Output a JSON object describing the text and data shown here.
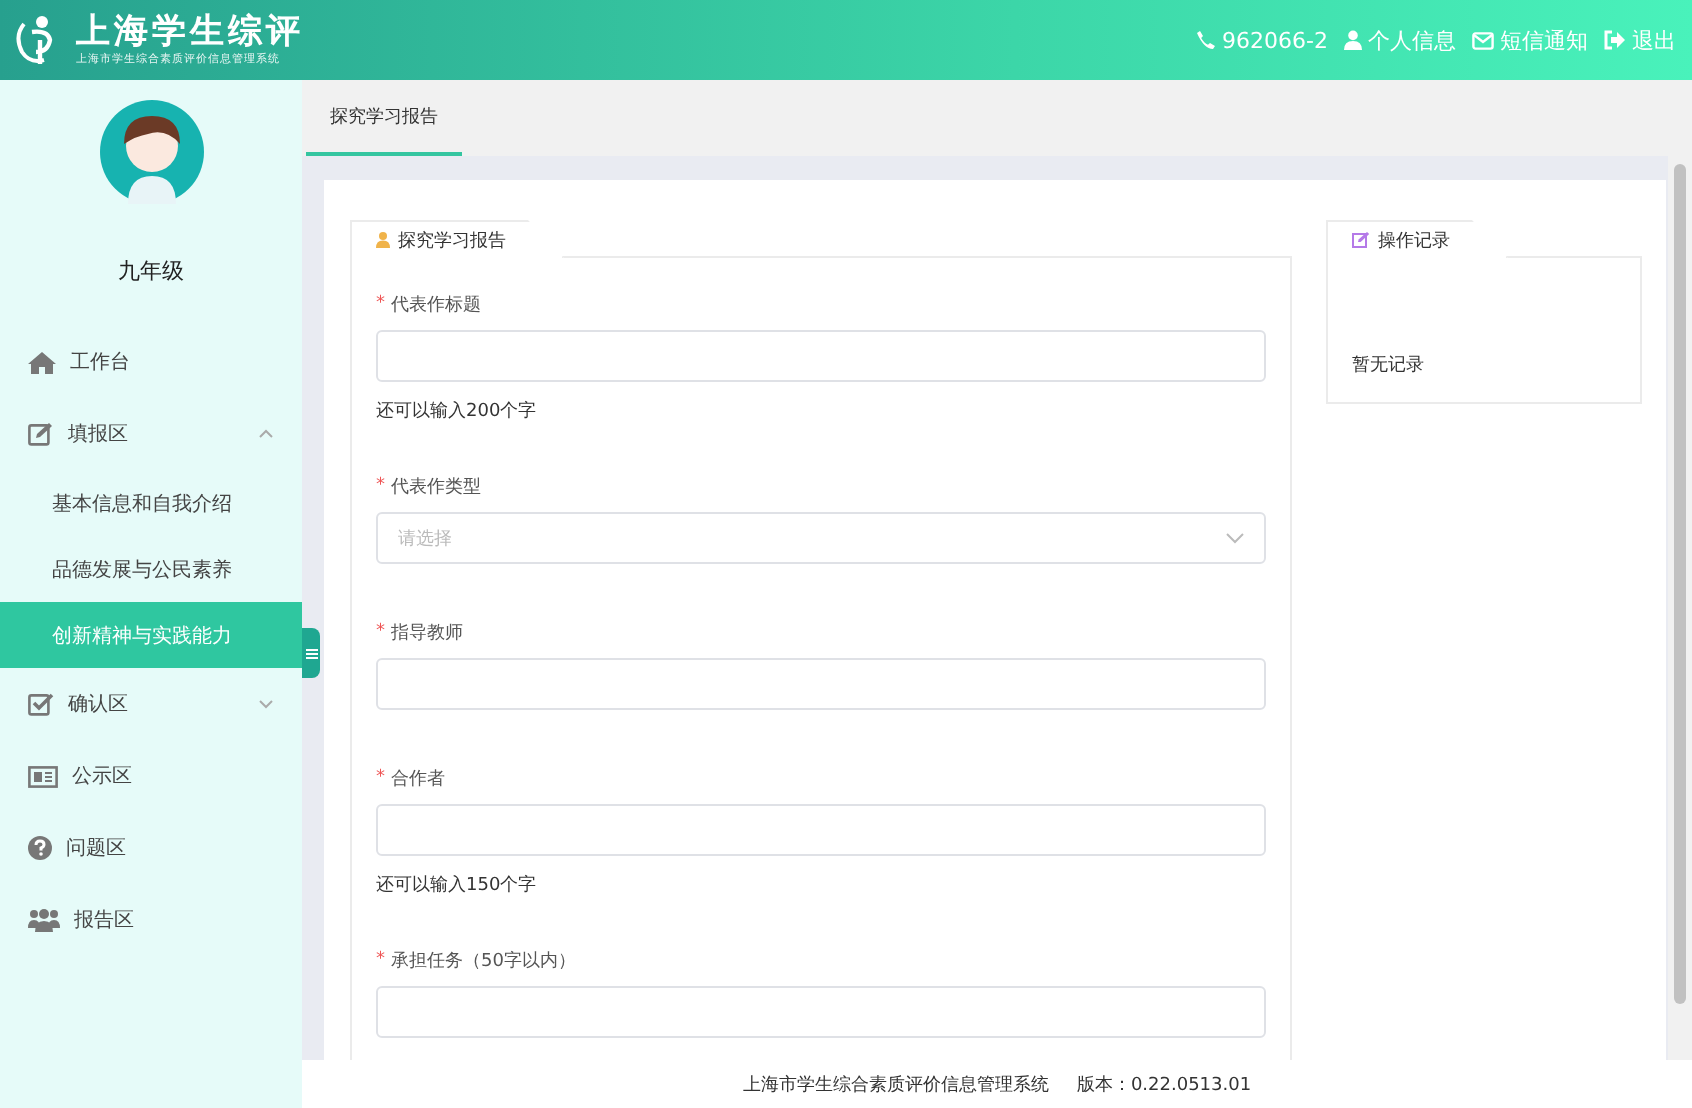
{
  "header": {
    "title": "上海学生综评",
    "subtitle": "上海市学生综合素质评价信息管理系统",
    "links": [
      {
        "kind": "phone",
        "label": "962066-2"
      },
      {
        "kind": "user",
        "label": "个人信息"
      },
      {
        "kind": "mail",
        "label": "短信通知"
      },
      {
        "kind": "logout",
        "label": "退出"
      }
    ]
  },
  "sidebar": {
    "grade": "九年级",
    "items": [
      {
        "kind": "home",
        "label": "工作台"
      },
      {
        "kind": "edit",
        "label": "填报区",
        "expanded": true,
        "children": [
          {
            "label": "基本信息和自我介绍",
            "selected": false
          },
          {
            "label": "品德发展与公民素养",
            "selected": false
          },
          {
            "label": "创新精神与实践能力",
            "selected": true
          }
        ]
      },
      {
        "kind": "check",
        "label": "确认区",
        "expanded": false
      },
      {
        "kind": "board",
        "label": "公示区"
      },
      {
        "kind": "question",
        "label": "问题区"
      },
      {
        "kind": "group",
        "label": "报告区"
      }
    ]
  },
  "tabs": [
    {
      "label": "探究学习报告",
      "selected": true
    }
  ],
  "form": {
    "title": "探究学习报告",
    "fields": [
      {
        "kind": "input",
        "required_mark": "*",
        "label": "代表作标题",
        "hint": "还可以输入200个字"
      },
      {
        "kind": "select",
        "required_mark": "*",
        "label": "代表作类型",
        "placeholder": "请选择"
      },
      {
        "kind": "input",
        "required_mark": "*",
        "label": "指导教师"
      },
      {
        "kind": "input",
        "required_mark": "*",
        "label": "合作者",
        "hint": "还可以输入150个字"
      },
      {
        "kind": "input",
        "required_mark": "*",
        "label": "承担任务（50字以内）"
      }
    ]
  },
  "log": {
    "title": "操作记录",
    "empty": "暂无记录"
  },
  "footer": {
    "system": "上海市学生综合素质评价信息管理系统",
    "version": "版本：0.22.0513.01"
  }
}
